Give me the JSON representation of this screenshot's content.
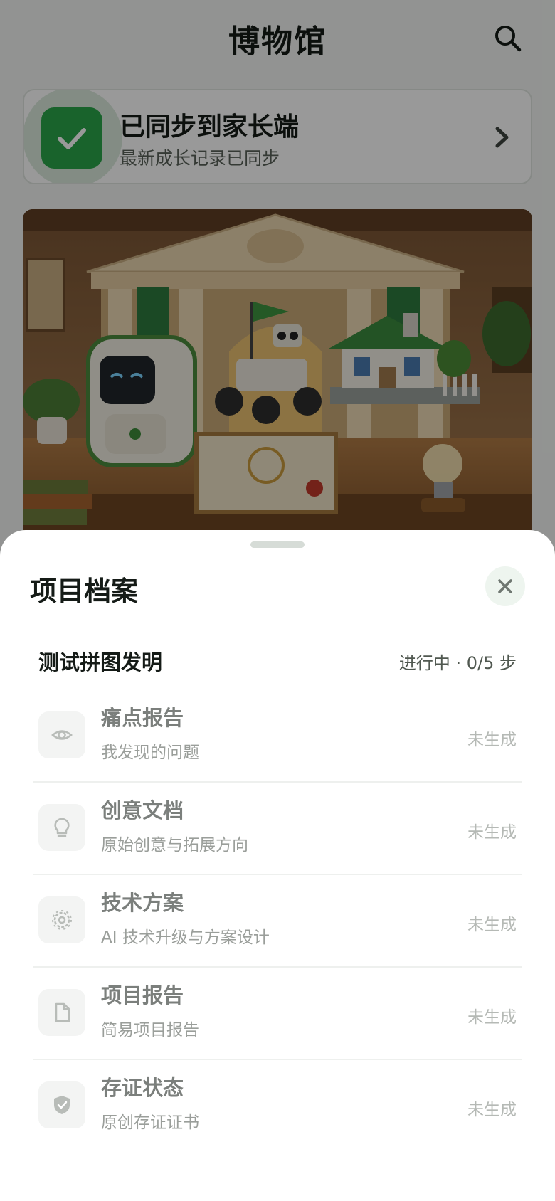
{
  "header": {
    "title": "博物馆",
    "search_icon": "search-icon"
  },
  "sync": {
    "title": "已同步到家长端",
    "subtitle": "最新成长记录已同步",
    "icon": "check-icon",
    "accent": "#2aa64a"
  },
  "hero": {
    "image": "museum-scene-illustration"
  },
  "sheet": {
    "title": "项目档案",
    "close_icon": "close-icon",
    "project": {
      "name": "测试拼图发明",
      "status": "进行中 · 0/5 步"
    },
    "items": [
      {
        "title": "痛点报告",
        "subtitle": "我发现的问题",
        "state": "未生成",
        "icon": "eye-icon"
      },
      {
        "title": "创意文档",
        "subtitle": "原始创意与拓展方向",
        "state": "未生成",
        "icon": "lightbulb-icon"
      },
      {
        "title": "技术方案",
        "subtitle": "AI 技术升级与方案设计",
        "state": "未生成",
        "icon": "gear-icon"
      },
      {
        "title": "项目报告",
        "subtitle": "简易项目报告",
        "state": "未生成",
        "icon": "document-icon"
      },
      {
        "title": "存证状态",
        "subtitle": "原创存证证书",
        "state": "未生成",
        "icon": "shield-check-icon"
      }
    ]
  }
}
